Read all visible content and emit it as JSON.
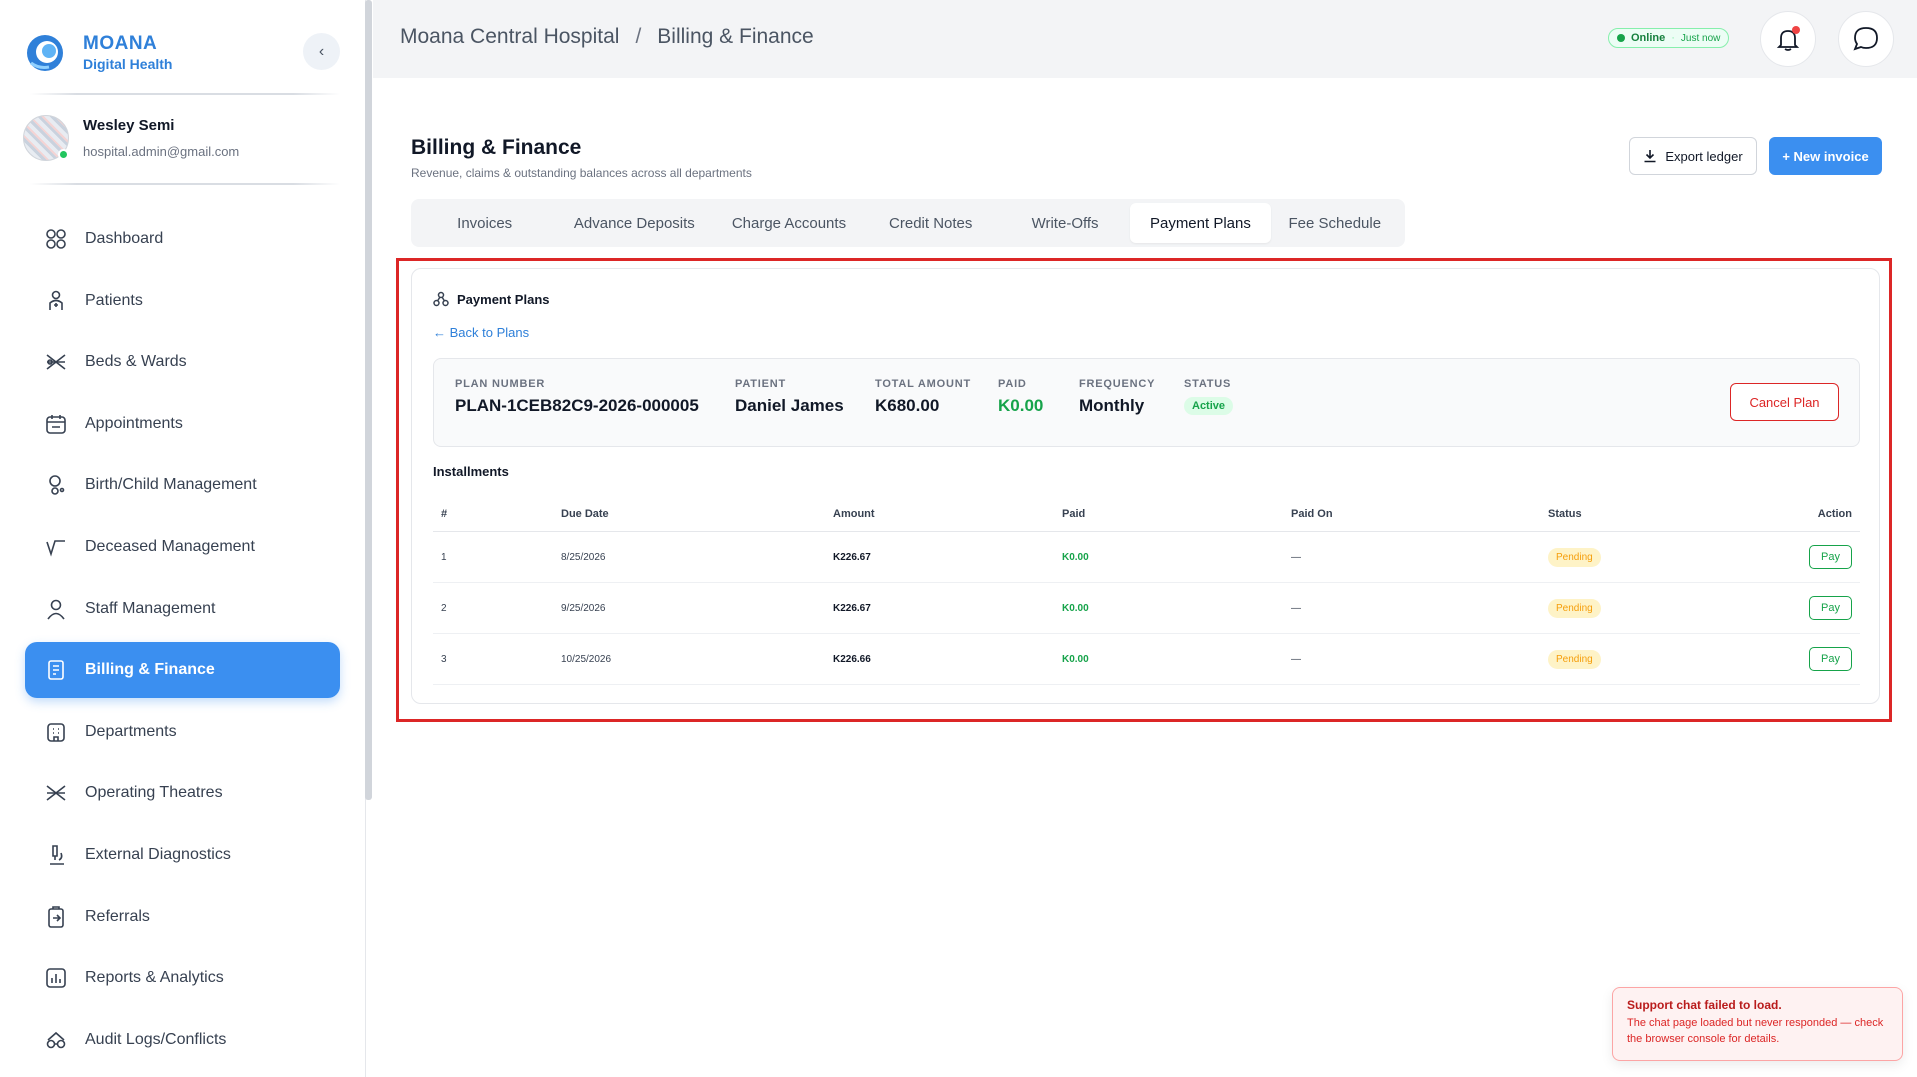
{
  "brand": {
    "name": "MOANA",
    "subtitle": "Digital Health"
  },
  "user": {
    "name": "Wesley Semi",
    "email": "hospital.admin@gmail.com"
  },
  "sidebar": {
    "items": [
      {
        "label": "Dashboard",
        "icon": "grid-icon"
      },
      {
        "label": "Patients",
        "icon": "patient-icon"
      },
      {
        "label": "Beds & Wards",
        "icon": "bed-icon"
      },
      {
        "label": "Appointments",
        "icon": "calendar-icon"
      },
      {
        "label": "Birth/Child Management",
        "icon": "baby-icon"
      },
      {
        "label": "Deceased Management",
        "icon": "pulse-icon"
      },
      {
        "label": "Staff Management",
        "icon": "staff-icon"
      },
      {
        "label": "Billing & Finance",
        "icon": "receipt-icon",
        "active": true
      },
      {
        "label": "Departments",
        "icon": "building-icon"
      },
      {
        "label": "Operating Theatres",
        "icon": "theatre-icon"
      },
      {
        "label": "External Diagnostics",
        "icon": "microscope-icon"
      },
      {
        "label": "Referrals",
        "icon": "clipboard-icon"
      },
      {
        "label": "Reports & Analytics",
        "icon": "chart-icon"
      },
      {
        "label": "Audit Logs/Conflicts",
        "icon": "audit-icon"
      }
    ]
  },
  "header": {
    "hospital": "Moana Central Hospital",
    "separator": "/",
    "section": "Billing & Finance",
    "status": {
      "label": "Online",
      "dot": "·",
      "time": "Just now"
    }
  },
  "page": {
    "title": "Billing & Finance",
    "subtitle": "Revenue, claims & outstanding balances across all departments",
    "export_label": "Export ledger",
    "new_label": "+ New invoice",
    "tabs": [
      "Invoices",
      "Advance Deposits",
      "Charge Accounts",
      "Credit Notes",
      "Write-Offs",
      "Payment Plans",
      "Fee Schedule"
    ],
    "active_tab": "Payment Plans"
  },
  "plan": {
    "card_title": "Payment Plans",
    "back_label": "← Back to Plans",
    "fields": {
      "plan_number_label": "PLAN NUMBER",
      "plan_number": "PLAN-1CEB82C9-2026-000005",
      "patient_label": "PATIENT",
      "patient": "Daniel James",
      "total_label": "TOTAL AMOUNT",
      "total": "K680.00",
      "paid_label": "PAID",
      "paid": "K0.00",
      "frequency_label": "FREQUENCY",
      "frequency": "Monthly",
      "status_label": "STATUS",
      "status": "Active"
    },
    "cancel_label": "Cancel Plan",
    "installments_title": "Installments",
    "columns": [
      "#",
      "Due Date",
      "Amount",
      "Paid",
      "Paid On",
      "Status",
      "Action"
    ],
    "rows": [
      {
        "num": "1",
        "due": "8/25/2026",
        "amount": "K226.67",
        "paid": "K0.00",
        "paid_on": "—",
        "status": "Pending",
        "action": "Pay"
      },
      {
        "num": "2",
        "due": "9/25/2026",
        "amount": "K226.67",
        "paid": "K0.00",
        "paid_on": "—",
        "status": "Pending",
        "action": "Pay"
      },
      {
        "num": "3",
        "due": "10/25/2026",
        "amount": "K226.66",
        "paid": "K0.00",
        "paid_on": "—",
        "status": "Pending",
        "action": "Pay"
      }
    ]
  },
  "toast": {
    "title": "Support chat failed to load.",
    "body": "The chat page loaded but never responded — check the browser console for details."
  },
  "colors": {
    "accent": "#3b8ff0",
    "brand": "#2f80d9",
    "success": "#16a34a",
    "danger": "#dc2626",
    "warning": "#f59e0b"
  }
}
